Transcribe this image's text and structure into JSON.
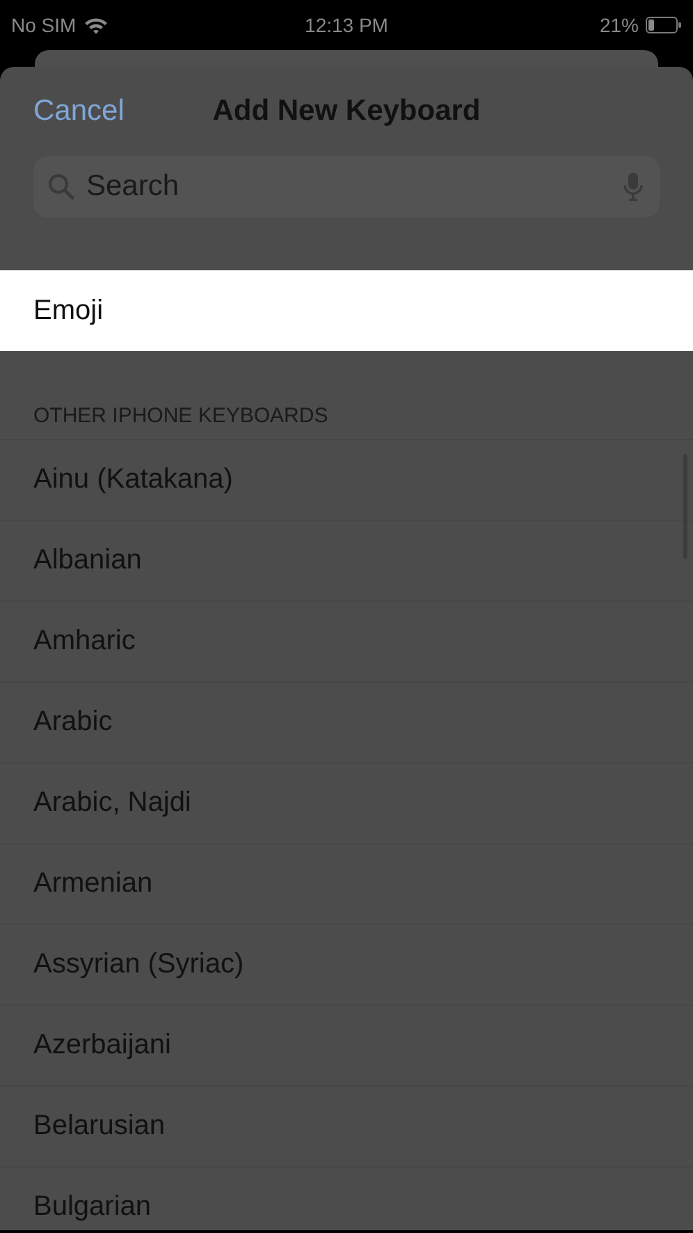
{
  "status_bar": {
    "carrier": "No SIM",
    "time": "12:13 PM",
    "battery": "21%"
  },
  "nav": {
    "cancel": "Cancel",
    "title": "Add New Keyboard"
  },
  "search": {
    "placeholder": "Search"
  },
  "highlighted_row": {
    "label": "Emoji",
    "selected": true
  },
  "section": {
    "header": "OTHER IPHONE KEYBOARDS",
    "items": [
      {
        "label": "Ainu (Katakana)",
        "selected": false
      },
      {
        "label": "Albanian",
        "selected": false
      },
      {
        "label": "Amharic",
        "selected": false
      },
      {
        "label": "Arabic",
        "selected": false
      },
      {
        "label": "Arabic, Najdi",
        "selected": false
      },
      {
        "label": "Armenian",
        "selected": false
      },
      {
        "label": "Assyrian (Syriac)",
        "selected": false
      },
      {
        "label": "Azerbaijani",
        "selected": false
      },
      {
        "label": "Belarusian",
        "selected": false
      },
      {
        "label": "Bulgarian",
        "selected": false
      }
    ]
  }
}
